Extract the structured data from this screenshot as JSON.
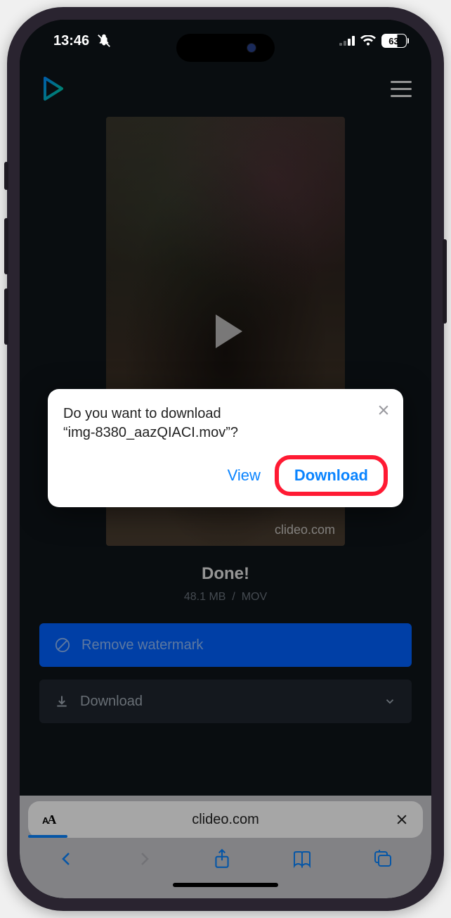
{
  "status_bar": {
    "time": "13:46",
    "battery": "63"
  },
  "page": {
    "watermark": "clideo.com",
    "done_label": "Done!",
    "file_size": "48.1 MB",
    "file_format": "MOV",
    "remove_watermark_label": "Remove watermark",
    "download_label": "Download"
  },
  "prompt": {
    "line1": "Do you want to download",
    "line2": "“img-8380_aazQIACI.mov”?",
    "view_label": "View",
    "download_label": "Download"
  },
  "browser": {
    "domain": "clideo.com"
  }
}
